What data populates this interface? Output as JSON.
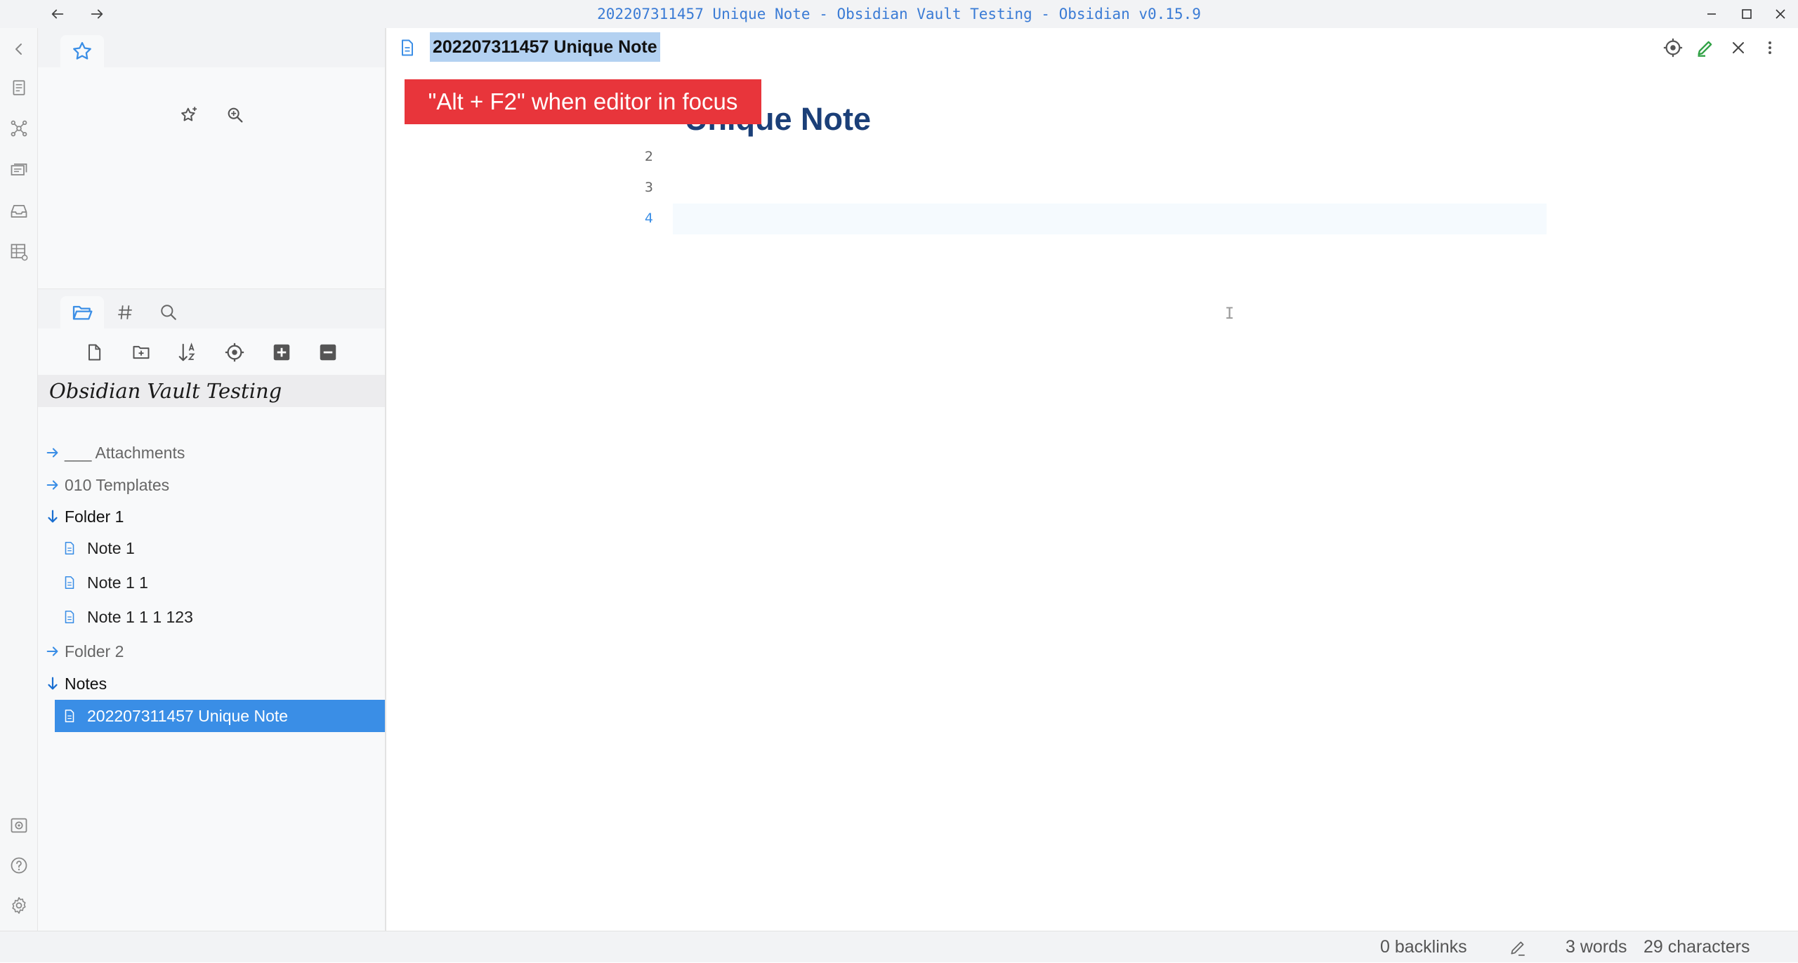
{
  "window": {
    "title": "202207311457 Unique Note - Obsidian Vault Testing - Obsidian v0.15.9"
  },
  "sidebar": {
    "vault_name": "Obsidian Vault Testing",
    "tree": [
      {
        "label": "___ Attachments",
        "type": "folder",
        "expanded": false
      },
      {
        "label": "010 Templates",
        "type": "folder",
        "expanded": false
      },
      {
        "label": "Folder 1",
        "type": "folder",
        "expanded": true
      },
      {
        "label": "Note 1",
        "type": "note"
      },
      {
        "label": "Note 1 1",
        "type": "note"
      },
      {
        "label": "Note 1 1 1 123",
        "type": "note"
      },
      {
        "label": "Folder 2",
        "type": "folder",
        "expanded": false
      },
      {
        "label": "Notes",
        "type": "folder",
        "expanded": true
      },
      {
        "label": "202207311457 Unique Note",
        "type": "note",
        "active": true
      }
    ]
  },
  "editor": {
    "title": "202207311457 Unique Note",
    "tooltip": "\"Alt + F2\" when editor in focus",
    "heading": "Unique Note",
    "line_numbers": [
      "2",
      "3",
      "4"
    ],
    "active_line": "4"
  },
  "statusbar": {
    "backlinks": "0 backlinks",
    "words": "3 words",
    "characters": "29 characters"
  },
  "colors": {
    "accent": "#3a8ee6",
    "title_text": "#3a7bd5",
    "tooltip_bg": "#e8353b",
    "heading": "#1b3f78",
    "edit_pencil": "#2ea043"
  },
  "icons": {
    "ribbon": [
      "collapse-arrow-icon",
      "daily-note-icon",
      "graph-view-icon",
      "slides-icon",
      "archive-icon",
      "table-icon",
      "vault-icon",
      "help-icon",
      "settings-icon"
    ],
    "header": [
      "file-icon",
      "locate-icon",
      "edit-pencil-icon",
      "close-icon",
      "more-options-icon"
    ]
  }
}
